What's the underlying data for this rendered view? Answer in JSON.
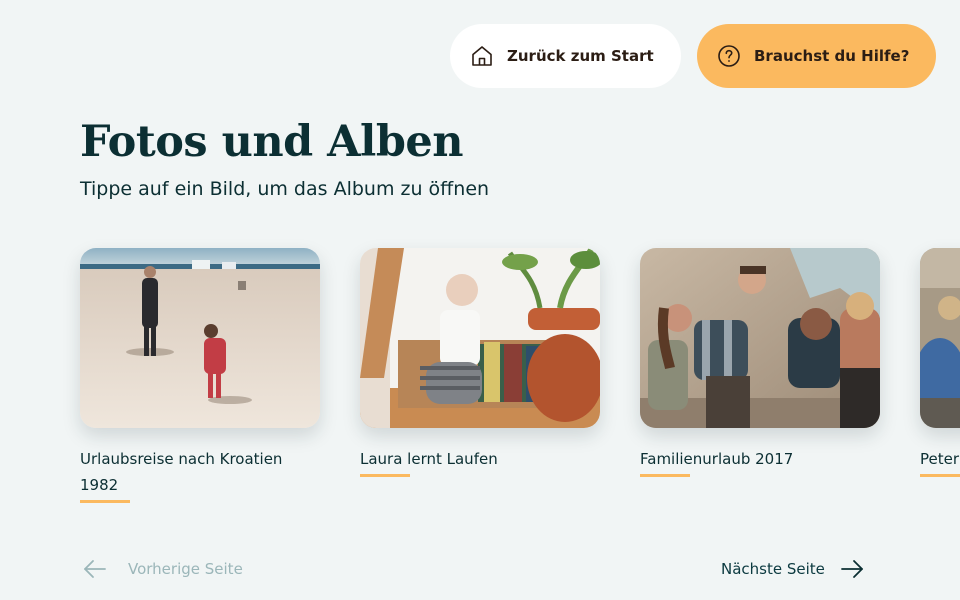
{
  "header": {
    "home_button": {
      "label": "Zurück zum Start",
      "icon": "home-icon"
    },
    "help_button": {
      "label": "Brauchst du Hilfe?",
      "icon": "question-circle-icon"
    }
  },
  "main": {
    "title": "Fotos und Alben",
    "subtitle": "Tippe auf ein Bild, um das Album zu öffnen",
    "albums": [
      {
        "label": "Urlaubsreise nach Kroatien 1982"
      },
      {
        "label": "Laura lernt Laufen"
      },
      {
        "label": "Familienurlaub 2017"
      },
      {
        "label": "Peter"
      }
    ]
  },
  "pagination": {
    "prev_label": "Vorherige Seite",
    "next_label": "Nächste Seite"
  },
  "colors": {
    "background": "#f1f5f5",
    "accent": "#fbb95f",
    "text_dark": "#0c2f33",
    "disabled": "#9bb6b9"
  }
}
